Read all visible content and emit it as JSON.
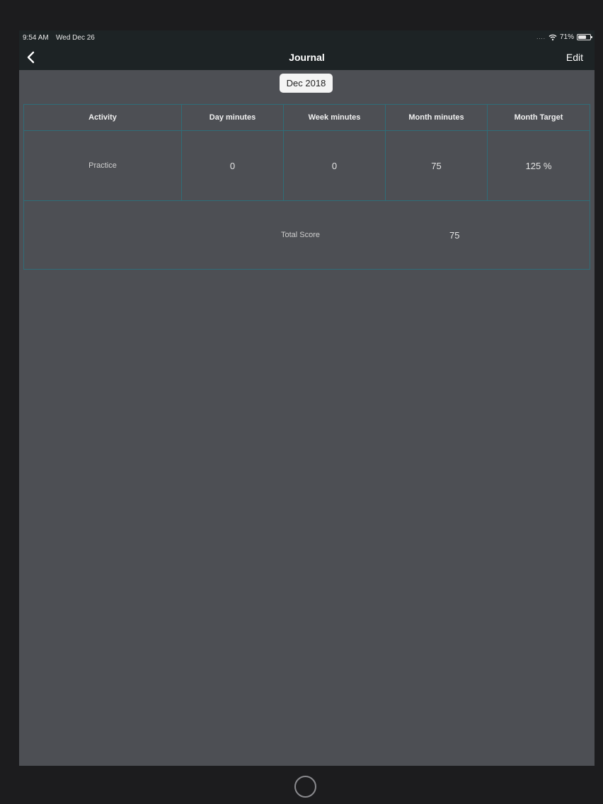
{
  "status_bar": {
    "time": "9:54 AM",
    "date": "Wed Dec 26",
    "signal": "....",
    "battery_text": "71%",
    "battery_level": 0.71
  },
  "nav": {
    "title": "Journal",
    "edit_label": "Edit",
    "back_icon": "chevron-left-icon"
  },
  "date_selector": {
    "label": "Dec 2018"
  },
  "table": {
    "headers": [
      "Activity",
      "Day minutes",
      "Week minutes",
      "Month minutes",
      "Month Target"
    ],
    "rows": [
      [
        "Practice",
        "0",
        "0",
        "75",
        "125 %"
      ]
    ],
    "total_label": "Total Score",
    "total_value": "75"
  },
  "colors": {
    "background": "#4d4f54",
    "bar": "#1d2325",
    "table_border": "#2f6d78"
  }
}
